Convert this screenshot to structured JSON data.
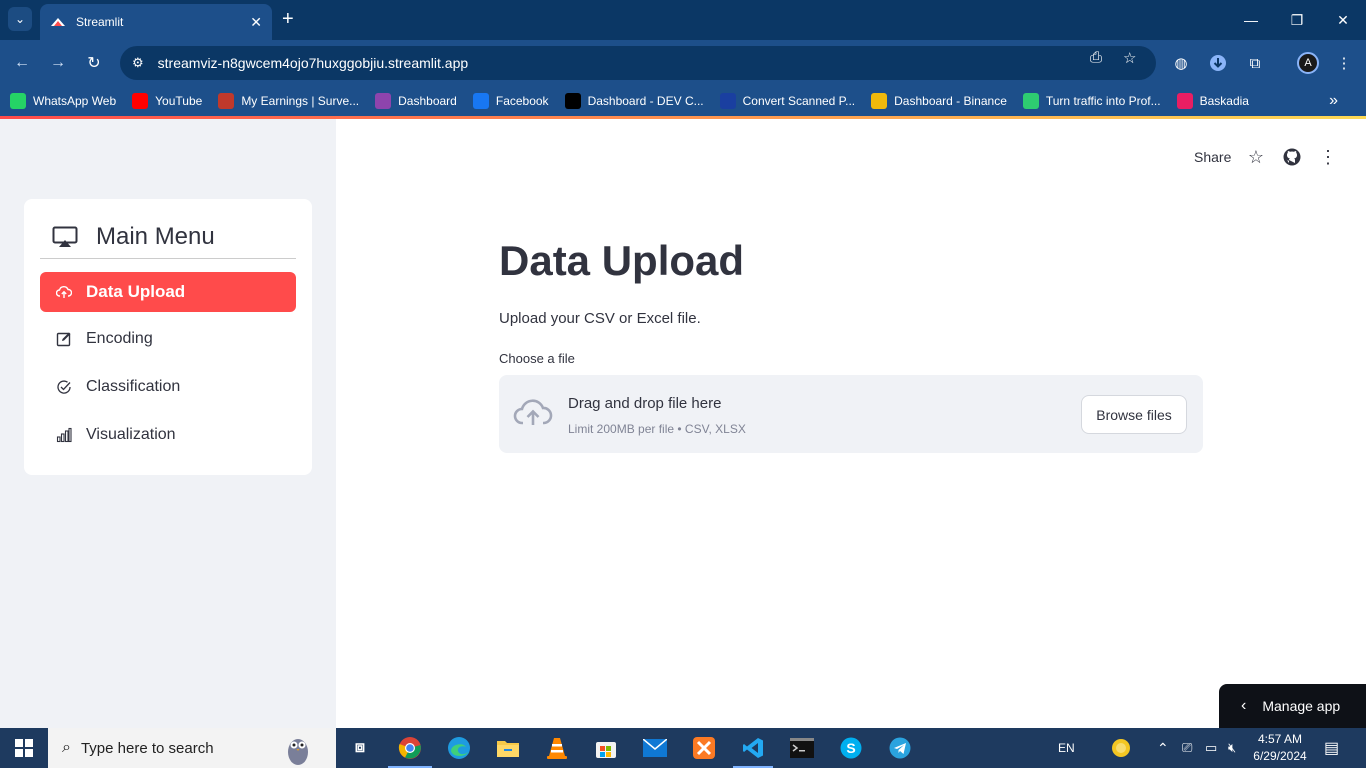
{
  "browser": {
    "tab_title": "Streamlit",
    "url": "streamviz-n8gwcem4ojo7huxggobjiu.streamlit.app",
    "bookmarks": [
      {
        "label": "WhatsApp Web",
        "icon": "whatsapp-icon",
        "color": "#25d366"
      },
      {
        "label": "YouTube",
        "icon": "youtube-icon",
        "color": "#ff0000"
      },
      {
        "label": "My Earnings | Surve...",
        "icon": "survey-icon",
        "color": "#c0392b"
      },
      {
        "label": "Dashboard",
        "icon": "dashboard-icon",
        "color": "#8e44ad"
      },
      {
        "label": "Facebook",
        "icon": "facebook-icon",
        "color": "#1877f2"
      },
      {
        "label": "Dashboard - DEV C...",
        "icon": "dev-icon",
        "color": "#000000"
      },
      {
        "label": "Convert Scanned P...",
        "icon": "convert-icon",
        "color": "#1a3fa0"
      },
      {
        "label": "Dashboard - Binance",
        "icon": "binance-icon",
        "color": "#f0b90b"
      },
      {
        "label": "Turn traffic into Prof...",
        "icon": "traffic-icon",
        "color": "#2ecc71"
      },
      {
        "label": "Baskadia",
        "icon": "baskadia-icon",
        "color": "#e91e63"
      }
    ]
  },
  "app": {
    "header": {
      "share_label": "Share"
    },
    "sidebar": {
      "menu_title": "Main Menu",
      "items": [
        {
          "label": "Data Upload",
          "icon": "cloud-upload-icon",
          "active": true
        },
        {
          "label": "Encoding",
          "icon": "edit-icon",
          "active": false
        },
        {
          "label": "Classification",
          "icon": "check-circle-icon",
          "active": false
        },
        {
          "label": "Visualization",
          "icon": "bar-chart-icon",
          "active": false
        }
      ]
    },
    "main": {
      "title": "Data Upload",
      "subtitle": "Upload your CSV or Excel file.",
      "uploader": {
        "label": "Choose a file",
        "drop_text": "Drag and drop file here",
        "limit_text": "Limit 200MB per file • CSV, XLSX",
        "browse_label": "Browse files"
      }
    },
    "manage_app_label": "Manage app"
  },
  "taskbar": {
    "search_placeholder": "Type here to search",
    "language": "EN",
    "time": "4:57 AM",
    "date": "6/29/2024"
  },
  "colors": {
    "accent": "#ff4b4b",
    "chrome_dark": "#0b3765",
    "chrome": "#1d4f8a",
    "sidebar_bg": "#f0f2f6",
    "text": "#31333f"
  }
}
